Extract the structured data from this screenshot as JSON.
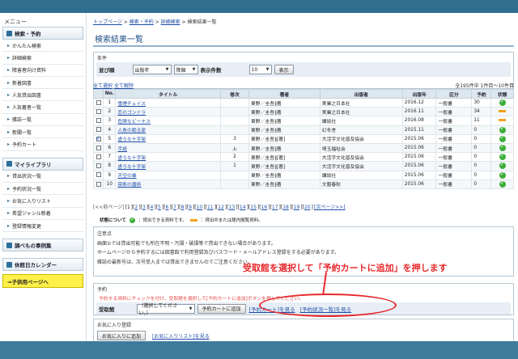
{
  "sidebar": {
    "heading": "メニュー",
    "sections": [
      {
        "title": "検索・予約",
        "items": [
          "かんたん検索",
          "詳細検索",
          "障害者向け資料",
          "新着図書",
          "人気貸出図書",
          "人気著者一覧",
          "雑誌一覧",
          "新聞一覧",
          "予約カート"
        ]
      },
      {
        "title": "マイライブラリ",
        "items": [
          "貸出状況一覧",
          "予約状況一覧",
          "お気に入りリスト",
          "希望ジャンル新着",
          "登録情報変更"
        ]
      },
      {
        "title": "調べもの事例集",
        "items": []
      },
      {
        "title": "休館日カレンダー",
        "items": []
      }
    ],
    "child_page": "⇒子供用ページへ"
  },
  "breadcrumb": [
    "トップページ",
    "検索・予約",
    "詳細検索",
    "検索結果一覧"
  ],
  "page_title": "検索結果一覧",
  "conditions": {
    "label": "条件",
    "sort_label": "並び順",
    "sort_field": "出版年",
    "sort_order": "降順",
    "count_label": "表示件数",
    "count_value": "10",
    "show_button": "表示"
  },
  "select_all": "全て選択",
  "deselect_all": "全て解除",
  "result_count": "全195件中 1件目～10件目",
  "table": {
    "headers": [
      "No.",
      "タイトル",
      "巻次",
      "著者",
      "出版者",
      "出版年",
      "区分",
      "予約",
      "状態"
    ],
    "rows": [
      {
        "checked": false,
        "no": "1",
        "title": "雪煙チェイス",
        "vol": "",
        "author": "東野／圭吾∥著",
        "publisher": "実業之日本社",
        "year": "2016.12",
        "kind": "一般書",
        "reserve": "30",
        "status": "ok"
      },
      {
        "checked": false,
        "no": "2",
        "title": "恋のゴンドラ",
        "vol": "",
        "author": "東野／圭吾∥著",
        "publisher": "実業之日本社",
        "year": "2016.11",
        "kind": "一般書",
        "reserve": "34",
        "status": "bar"
      },
      {
        "checked": false,
        "no": "3",
        "title": "危険なビーナス",
        "vol": "",
        "author": "東野／圭吾∥著",
        "publisher": "講談社",
        "year": "2016.08",
        "kind": "一般書",
        "reserve": "11",
        "status": "bar"
      },
      {
        "checked": false,
        "no": "4",
        "title": "人魚の眠る家",
        "vol": "",
        "author": "東野／圭吾∥著",
        "publisher": "幻冬舎",
        "year": "2015.11",
        "kind": "一般書",
        "reserve": "0",
        "status": "ok"
      },
      {
        "checked": true,
        "no": "5",
        "title": "虚ろな十字架",
        "vol": "3",
        "author": "東野／圭吾∥[著]",
        "publisher": "大活字文化普及協会",
        "year": "2015.06",
        "kind": "一般書",
        "reserve": "0",
        "status": "ok"
      },
      {
        "checked": false,
        "no": "6",
        "title": "手紙",
        "vol": "上",
        "author": "東野／圭吾∥著",
        "publisher": "埼玉福祉会",
        "year": "2015.06",
        "kind": "一般書",
        "reserve": "0",
        "status": "ok"
      },
      {
        "checked": false,
        "no": "7",
        "title": "虚ろな十字架",
        "vol": "2",
        "author": "東野／圭吾∥[著]",
        "publisher": "大活字文化普及協会",
        "year": "2015.06",
        "kind": "一般書",
        "reserve": "0",
        "status": "ok"
      },
      {
        "checked": false,
        "no": "8",
        "title": "虚ろな十字架",
        "vol": "1",
        "author": "東野／圭吾∥[著]",
        "publisher": "大活字文化普及協会",
        "year": "2015.06",
        "kind": "一般書",
        "reserve": "0",
        "status": "ok"
      },
      {
        "checked": false,
        "no": "9",
        "title": "天空の蜂",
        "vol": "",
        "author": "東野／圭吾∥著",
        "publisher": "講談社",
        "year": "2015.06",
        "kind": "一般書",
        "reserve": "0",
        "status": "ok"
      },
      {
        "checked": false,
        "no": "10",
        "title": "禁断の魔術",
        "vol": "",
        "author": "東野／圭吾∥著",
        "publisher": "文藝春秋",
        "year": "2015.06",
        "kind": "一般書",
        "reserve": "0",
        "status": "ok"
      }
    ]
  },
  "pager": {
    "prev": "[<<前ページ]",
    "pages": [
      "1",
      "2",
      "3",
      "4",
      "5",
      "6",
      "7",
      "8",
      "9",
      "10",
      "11",
      "12",
      "13",
      "14",
      "15",
      "16",
      "17",
      "18",
      "19",
      "20"
    ],
    "next": "[次ページ>>]"
  },
  "legend": {
    "label": "状態について",
    "ok_text": "：貸出できる資料です。",
    "bar_text": "：貸出中または館内閲覧資料。"
  },
  "notes": {
    "label": "注意点",
    "lines": [
      "画面①では貸出可能でも所在不明・汚損・破損等で貸出できない場合があります。",
      "ホームページから予約するには図書館で利用登録及びパスワード・メールアドレス登録をする必要があります。",
      "雑誌の最新号は、次号受入までは貸出できませんのでご注意ください。"
    ]
  },
  "annotation": "受取館を選択して「予約カートに追加」を押します",
  "reserve": {
    "label": "予約",
    "warning": "予約する資料にチェックを付け、受取館を選択して[予約カートに追加]ボタンを押してください。",
    "pickup_label": "受取館",
    "pickup_value": "（選択してください。）",
    "add_button": "予約カートに追加",
    "link_cart": "[予約カート]を見る",
    "link_status": "[予約状況一覧]を見る"
  },
  "favorites": {
    "label": "お気に入り登録",
    "add_button": "お気に入りに追加",
    "link": "[お気に入りリスト]を見る"
  },
  "colors": {
    "accent": "#2f6e8f",
    "title": "#1f4f86",
    "annotation": "#e8292d",
    "yellow": "#fff14a"
  }
}
